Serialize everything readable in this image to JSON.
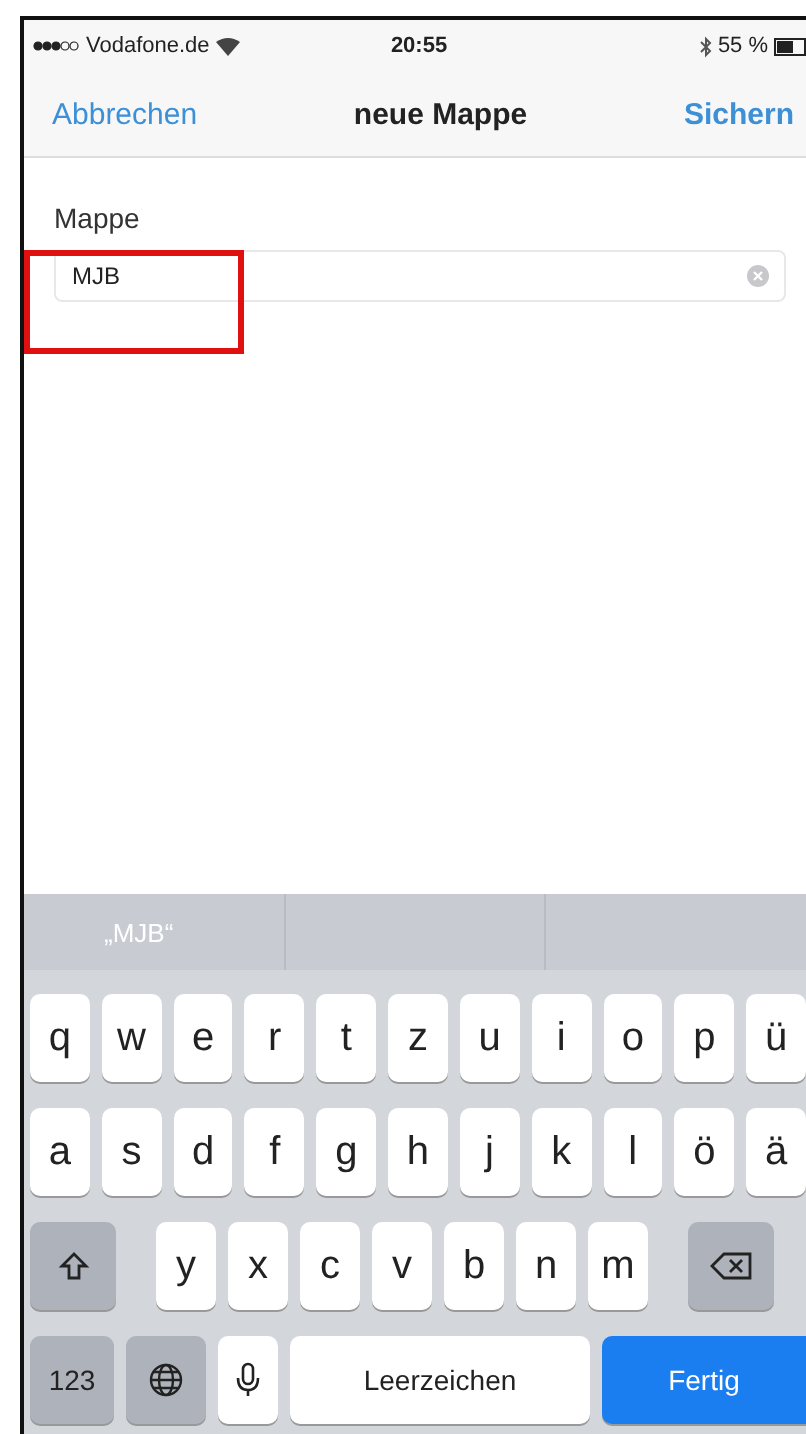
{
  "status_bar": {
    "carrier": "Vodafone.de",
    "time": "20:55",
    "battery": "55 %"
  },
  "nav_bar": {
    "cancel": "Abbrechen",
    "title": "neue Mappe",
    "save": "Sichern"
  },
  "form": {
    "label": "Mappe",
    "field": {
      "value": "MJB"
    }
  },
  "suggestions": [
    "„MJB“"
  ],
  "keyboard": {
    "rows": [
      {
        "keys": [
          {
            "kind": "letter",
            "label": "q"
          },
          {
            "kind": "letter",
            "label": "w"
          },
          {
            "kind": "letter",
            "label": "e"
          },
          {
            "kind": "letter",
            "label": "r"
          },
          {
            "kind": "letter",
            "label": "t"
          },
          {
            "kind": "letter",
            "label": "z"
          },
          {
            "kind": "letter",
            "label": "u"
          },
          {
            "kind": "letter",
            "label": "i"
          },
          {
            "kind": "letter",
            "label": "o"
          },
          {
            "kind": "letter",
            "label": "p"
          },
          {
            "kind": "letter",
            "label": "ü"
          }
        ]
      },
      {
        "keys": [
          {
            "kind": "letter",
            "label": "a"
          },
          {
            "kind": "letter",
            "label": "s"
          },
          {
            "kind": "letter",
            "label": "d"
          },
          {
            "kind": "letter",
            "label": "f"
          },
          {
            "kind": "letter",
            "label": "g"
          },
          {
            "kind": "letter",
            "label": "h"
          },
          {
            "kind": "letter",
            "label": "j"
          },
          {
            "kind": "letter",
            "label": "k"
          },
          {
            "kind": "letter",
            "label": "l"
          },
          {
            "kind": "letter",
            "label": "ö"
          },
          {
            "kind": "letter",
            "label": "ä"
          }
        ]
      },
      {
        "keys": [
          {
            "kind": "shift"
          },
          {
            "kind": "letter",
            "label": "y"
          },
          {
            "kind": "letter",
            "label": "x"
          },
          {
            "kind": "letter",
            "label": "c"
          },
          {
            "kind": "letter",
            "label": "v"
          },
          {
            "kind": "letter",
            "label": "b"
          },
          {
            "kind": "letter",
            "label": "n"
          },
          {
            "kind": "letter",
            "label": "m"
          },
          {
            "kind": "backspace"
          }
        ]
      },
      {
        "keys": [
          {
            "kind": "numbers",
            "label": "123"
          },
          {
            "kind": "globe"
          },
          {
            "kind": "mic"
          },
          {
            "kind": "space",
            "label": "Leerzeichen"
          },
          {
            "kind": "done",
            "label": "Fertig"
          }
        ]
      }
    ]
  }
}
